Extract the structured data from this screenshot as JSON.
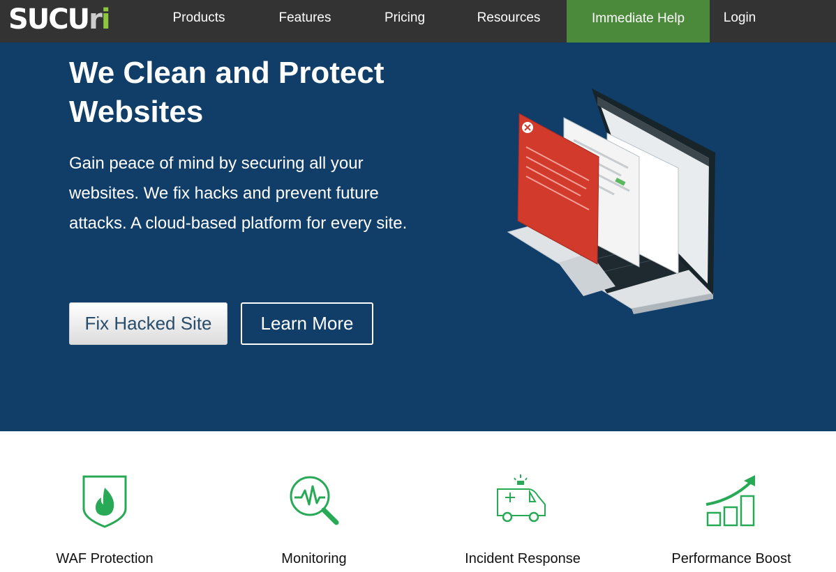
{
  "nav": {
    "logo_main": "SUCU",
    "logo_accent": "r",
    "logo_tail": "i",
    "items": [
      {
        "label": "Products"
      },
      {
        "label": "Features"
      },
      {
        "label": "Pricing"
      },
      {
        "label": "Resources"
      },
      {
        "label": "Immediate Help"
      },
      {
        "label": "Login"
      }
    ]
  },
  "hero": {
    "title": "We Clean and Protect Websites",
    "subtitle": "Gain peace of mind by securing all your websites. We fix hacks and prevent future attacks. A cloud-based platform for every site.",
    "primary_button": "Fix Hacked Site",
    "secondary_button": "Learn More",
    "illustration": "laptop-dashboard-illustration"
  },
  "features": [
    {
      "label": "WAF Protection",
      "icon": "shield-fire-icon"
    },
    {
      "label": "Monitoring",
      "icon": "magnifier-pulse-icon"
    },
    {
      "label": "Incident Response",
      "icon": "ambulance-icon"
    },
    {
      "label": "Performance Boost",
      "icon": "growth-chart-icon"
    }
  ],
  "colors": {
    "nav_bg": "#333333",
    "hero_bg": "#103e69",
    "help_bg": "#4a8a3a",
    "icon_green": "#27a956"
  }
}
